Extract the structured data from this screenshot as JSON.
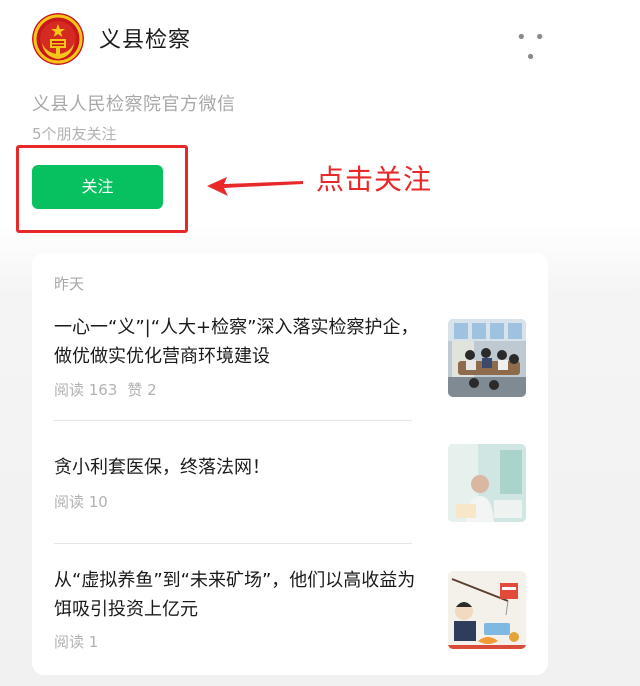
{
  "account": {
    "name": "义县检察",
    "description": "义县人民检察院官方微信",
    "friends_following": "5个朋友关注",
    "more_label": "• • •"
  },
  "follow_button": {
    "label": "关注"
  },
  "annotation": {
    "text": "点击关注"
  },
  "articles_section": {
    "date_label": "昨天",
    "articles": [
      {
        "title": "一心一“义”|“人大+检察”深入落实检察护企，做优做实优化营商环境建设",
        "reads": "阅读 163",
        "likes": "赞 2"
      },
      {
        "title": "贪小利套医保，终落法网！",
        "reads": "阅读 10"
      },
      {
        "title": "从“虚拟养鱼”到“未来矿场”，他们以高收益为饵吸引投资上亿元",
        "reads": "阅读 1"
      }
    ]
  },
  "colors": {
    "follow_green": "#07c160",
    "annotation_red": "#e8292a",
    "emblem_red": "#c8161d",
    "emblem_gold": "#f5c518"
  },
  "icons": [
    "procuratorate-emblem",
    "more-icon",
    "arrow-left"
  ]
}
